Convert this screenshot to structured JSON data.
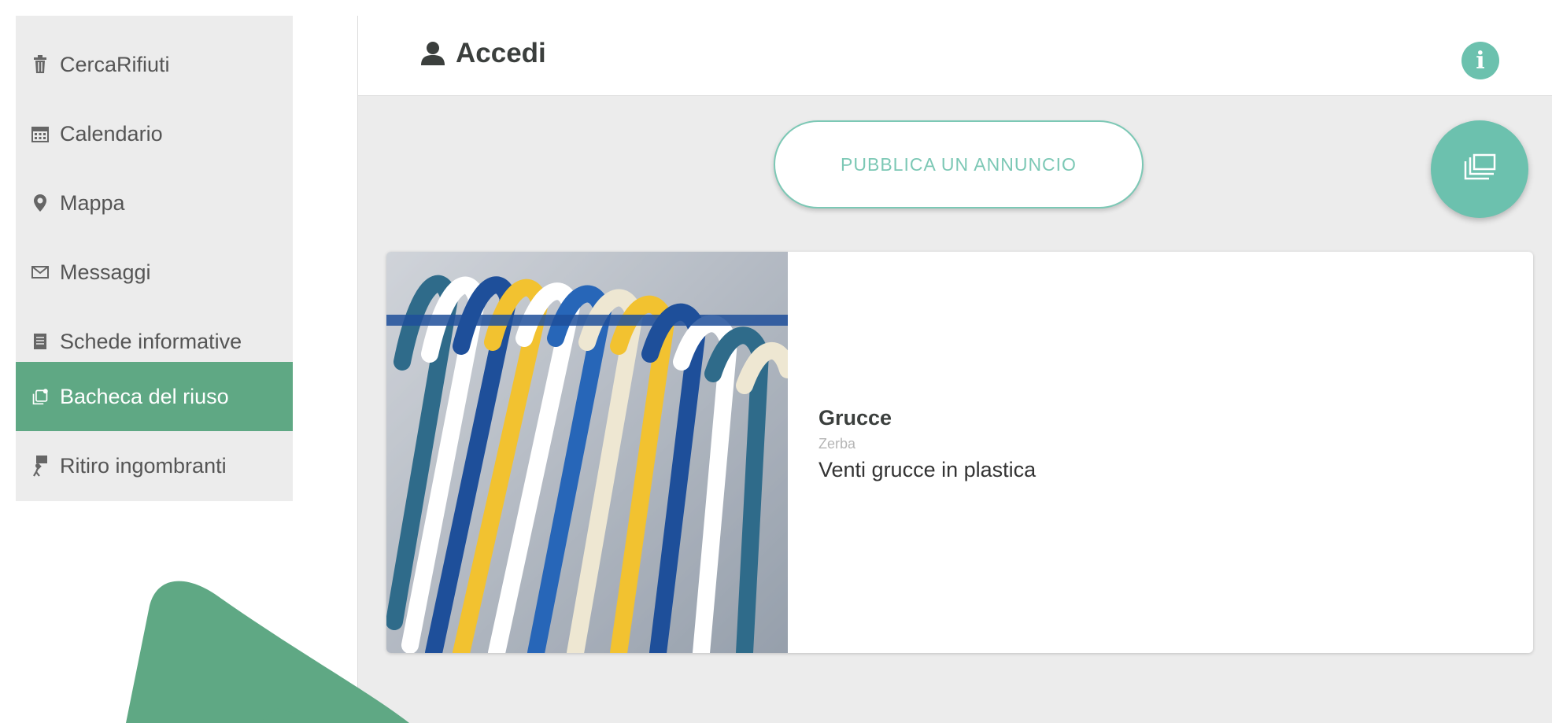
{
  "sidebar": {
    "items": [
      {
        "label": "CercaRifiuti",
        "icon": "trash-icon"
      },
      {
        "label": "Calendario",
        "icon": "calendar-icon"
      },
      {
        "label": "Mappa",
        "icon": "map-pin-icon"
      },
      {
        "label": "Messaggi",
        "icon": "envelope-icon"
      },
      {
        "label": "Schede informative",
        "icon": "document-icon"
      },
      {
        "label": "Bacheca del riuso",
        "icon": "reuse-board-icon",
        "active": true
      },
      {
        "label": "Ritiro ingombranti",
        "icon": "bulky-pickup-icon"
      }
    ]
  },
  "header": {
    "login_label": "Accedi",
    "login_icon": "user-icon",
    "info_icon": "info-icon",
    "info_glyph": "i"
  },
  "actions": {
    "publish_label": "PUBBLICA UN ANNUNCIO",
    "fab_icon": "gallery-icon"
  },
  "listing": {
    "title": "Grucce",
    "location": "Zerba",
    "description": "Venti grucce in plastica",
    "image_icon": "hangers-photo"
  },
  "colors": {
    "accent": "#5fa884",
    "teal": "#6cc1ae",
    "sidebar_bg": "#ececec",
    "arrow": "#5fa884"
  }
}
